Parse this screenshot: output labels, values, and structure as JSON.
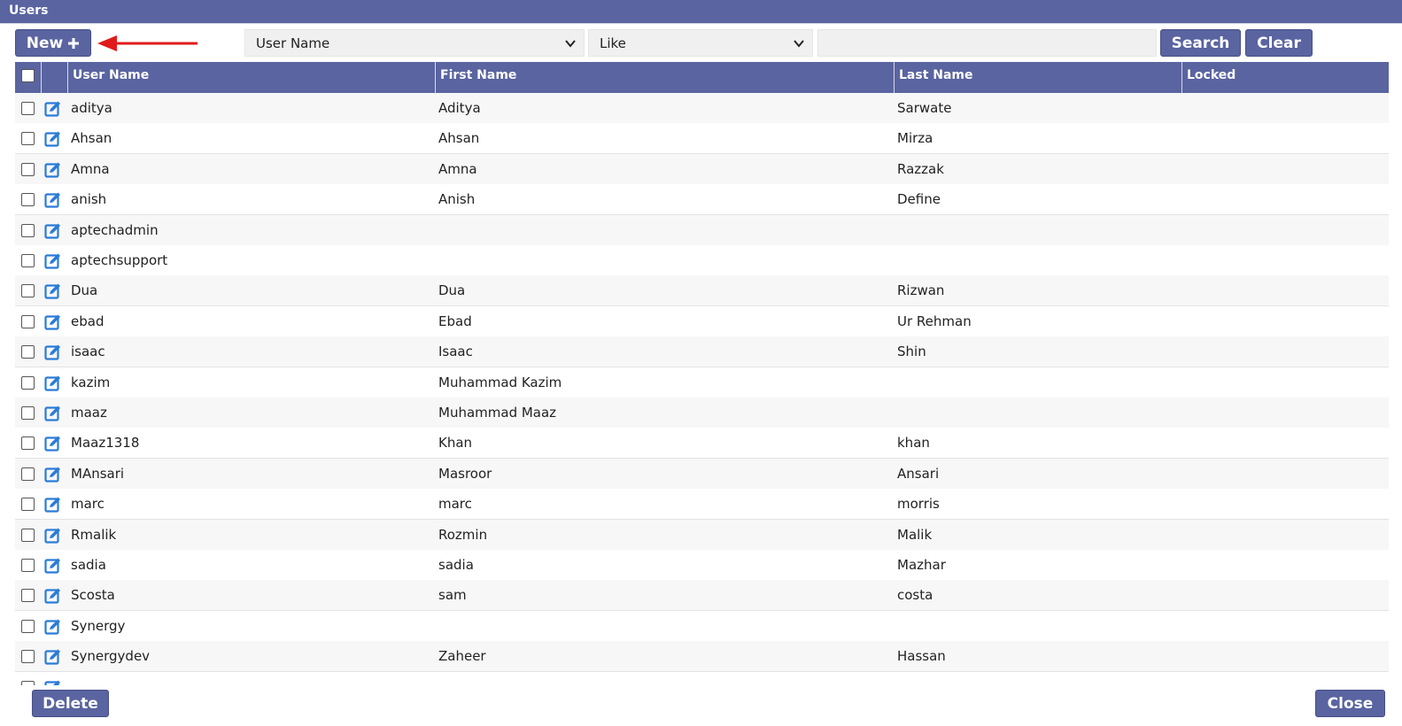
{
  "window": {
    "title": "Users"
  },
  "toolbar": {
    "new_label": "New",
    "field_select": "User Name",
    "operator_select": "Like",
    "search_value": "",
    "search_label": "Search",
    "clear_label": "Clear"
  },
  "table": {
    "columns": [
      "User Name",
      "First Name",
      "Last Name",
      "Locked"
    ],
    "rows": [
      {
        "user": "aditya",
        "first": "Aditya",
        "last": "Sarwate"
      },
      {
        "user": "Ahsan",
        "first": "Ahsan",
        "last": "Mirza"
      },
      {
        "user": "Amna",
        "first": "Amna",
        "last": "Razzak"
      },
      {
        "user": "anish",
        "first": "Anish",
        "last": "Define"
      },
      {
        "user": "aptechadmin",
        "first": "",
        "last": ""
      },
      {
        "user": "aptechsupport",
        "first": "",
        "last": ""
      },
      {
        "user": "Dua",
        "first": "Dua",
        "last": "Rizwan"
      },
      {
        "user": "ebad",
        "first": "Ebad",
        "last": "Ur Rehman"
      },
      {
        "user": "isaac",
        "first": "Isaac",
        "last": "Shin"
      },
      {
        "user": "kazim",
        "first": "Muhammad Kazim",
        "last": ""
      },
      {
        "user": "maaz",
        "first": "Muhammad Maaz",
        "last": ""
      },
      {
        "user": "Maaz1318",
        "first": "Khan",
        "last": "khan"
      },
      {
        "user": "MAnsari",
        "first": "Masroor",
        "last": "Ansari"
      },
      {
        "user": "marc",
        "first": "marc",
        "last": "morris"
      },
      {
        "user": "Rmalik",
        "first": "Rozmin",
        "last": "Malik"
      },
      {
        "user": "sadia",
        "first": "sadia",
        "last": "Mazhar"
      },
      {
        "user": "Scosta",
        "first": "sam",
        "last": "costa"
      },
      {
        "user": "Synergy",
        "first": "",
        "last": ""
      },
      {
        "user": "Synergydev",
        "first": "Zaheer",
        "last": "Hassan"
      },
      {
        "user": "",
        "first": "",
        "last": ""
      }
    ]
  },
  "footer": {
    "delete_label": "Delete",
    "close_label": "Close"
  },
  "colors": {
    "header": "#5a64a0",
    "edit_icon": "#2a7bd8",
    "arrow": "#e01b1b"
  },
  "icons": {
    "edit": "edit-icon",
    "plus": "plus-icon",
    "chevron": "chevron-down-icon"
  }
}
